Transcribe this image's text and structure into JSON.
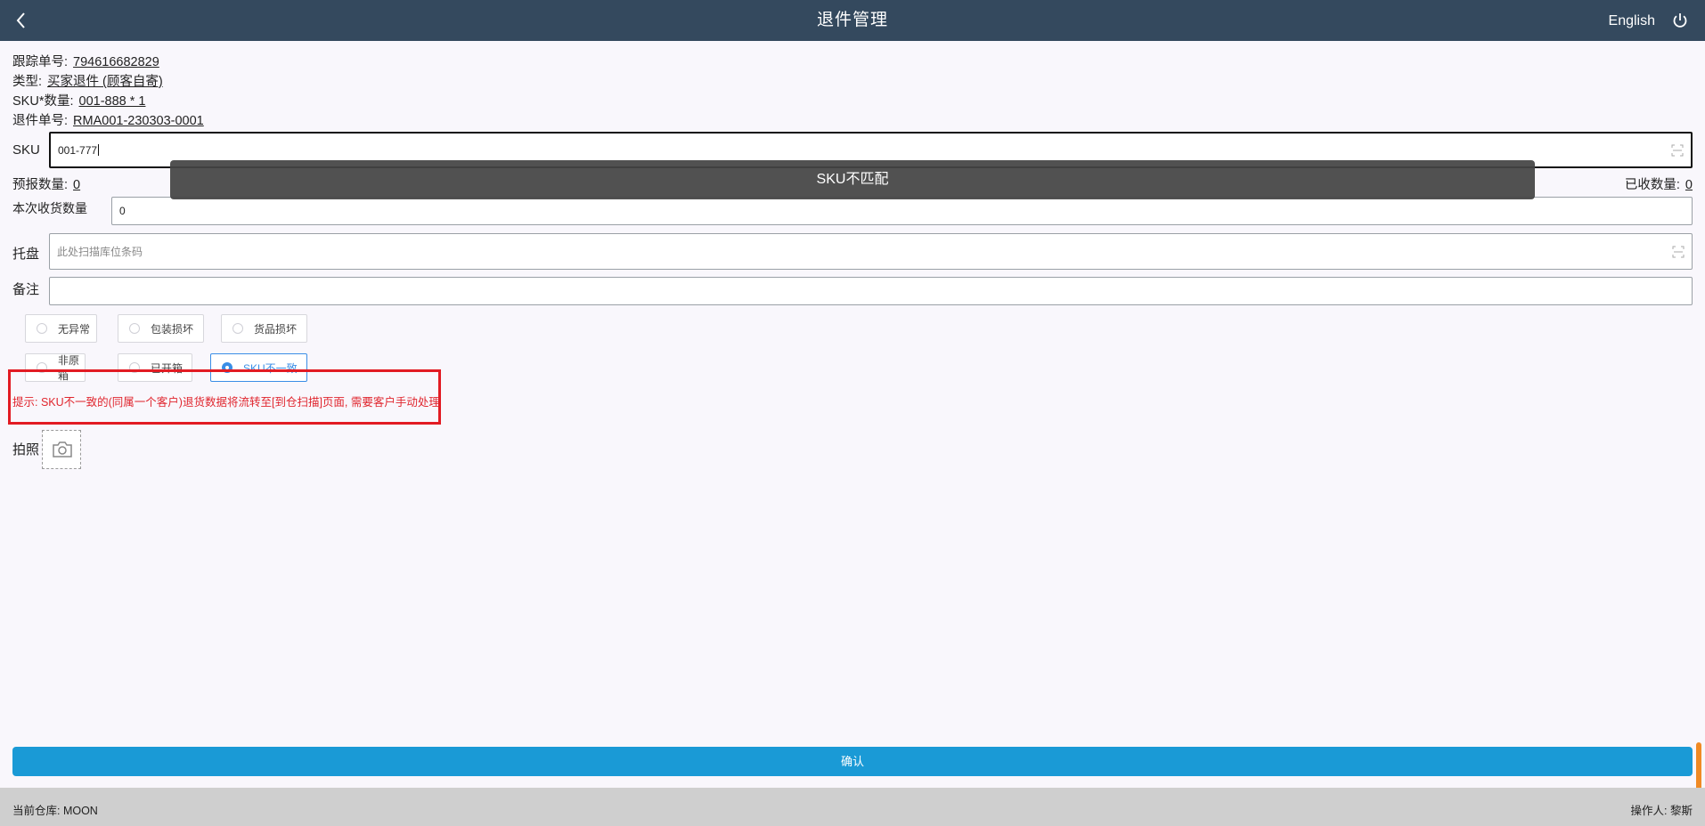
{
  "header": {
    "title": "退件管理",
    "language": "English"
  },
  "info": {
    "tracking_label": "跟踪单号:",
    "tracking_value": "794616682829",
    "type_label": "类型:",
    "type_value": "买家退件 (顾客自寄)",
    "sku_qty_label": "SKU*数量:",
    "sku_qty_value": "001-888 * 1",
    "return_no_label": "退件单号:",
    "return_no_value": "RMA001-230303-0001"
  },
  "sku_field": {
    "label": "SKU",
    "value": "001-777"
  },
  "toast": {
    "message": "SKU不匹配"
  },
  "counts": {
    "forecast_label": "预报数量:",
    "forecast_value": "0",
    "received_label": "已收数量:",
    "received_value": "0"
  },
  "receive_qty": {
    "label": "本次收货数量",
    "value": "0"
  },
  "pallet": {
    "label": "托盘",
    "placeholder": "此处扫描库位条码"
  },
  "remark": {
    "label": "备注",
    "value": ""
  },
  "conditions": [
    {
      "label": "无异常",
      "selected": false
    },
    {
      "label": "包装损坏",
      "selected": false
    },
    {
      "label": "货品损坏",
      "selected": false
    },
    {
      "label": "非原箱",
      "selected": false
    },
    {
      "label": "已开箱",
      "selected": false
    },
    {
      "label": "SKU不一致",
      "selected": true
    }
  ],
  "hint": "提示: SKU不一致的(同属一个客户)退货数据将流转至[到仓扫描]页面, 需要客户手动处理",
  "photo": {
    "label": "拍照"
  },
  "confirm_label": "确认",
  "footer": {
    "warehouse": "当前仓库: MOON",
    "operator": "操作人: 黎斯"
  },
  "colors": {
    "header_bg": "#34495e",
    "primary": "#1a9ad6",
    "selected": "#3a8ee6",
    "hint_red": "#e21b23",
    "scroll_accent": "#f08a24"
  }
}
